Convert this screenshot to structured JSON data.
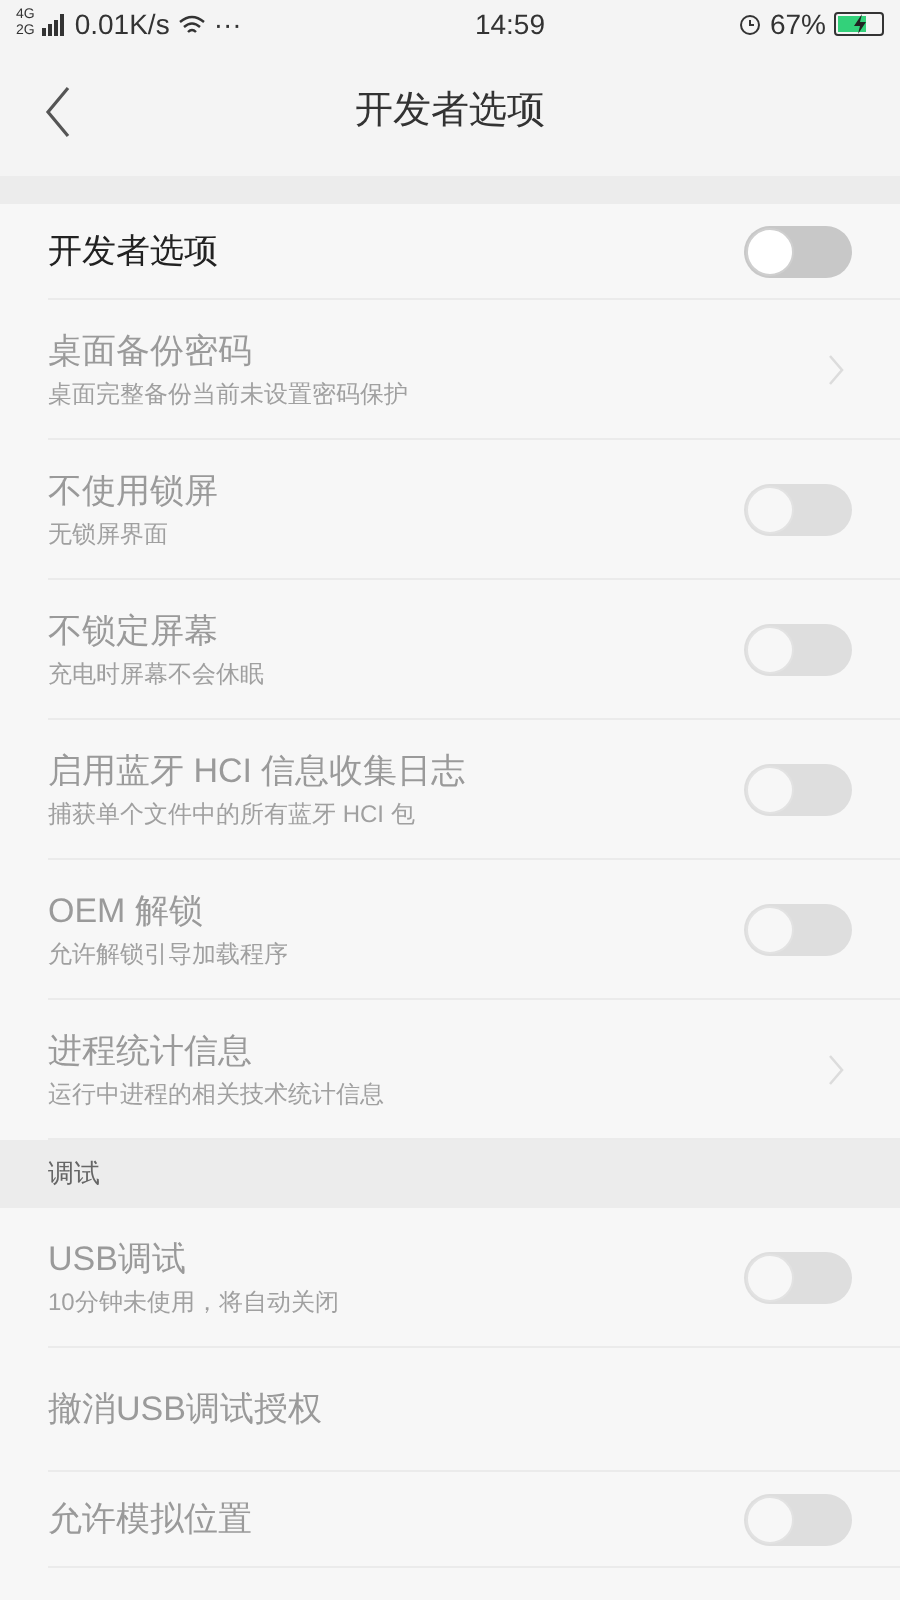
{
  "status_bar": {
    "network": [
      "4G",
      "2G"
    ],
    "speed": "0.01K/s",
    "more": "···",
    "time": "14:59",
    "battery": "67%",
    "charging": true
  },
  "header": {
    "title": "开发者选项"
  },
  "sections": [
    {
      "items": [
        {
          "kind": "toggle",
          "title": "开发者选项",
          "on": false,
          "disabled": false
        },
        {
          "kind": "link",
          "title": "桌面备份密码",
          "subtitle": "桌面完整备份当前未设置密码保护",
          "disabled": true
        },
        {
          "kind": "toggle",
          "title": "不使用锁屏",
          "subtitle": "无锁屏界面",
          "on": false,
          "disabled": true
        },
        {
          "kind": "toggle",
          "title": "不锁定屏幕",
          "subtitle": "充电时屏幕不会休眠",
          "on": false,
          "disabled": true
        },
        {
          "kind": "toggle",
          "title": "启用蓝牙 HCI 信息收集日志",
          "subtitle": "捕获单个文件中的所有蓝牙 HCI 包",
          "on": false,
          "disabled": true
        },
        {
          "kind": "toggle",
          "title": "OEM 解锁",
          "subtitle": "允许解锁引导加载程序",
          "on": false,
          "disabled": true
        },
        {
          "kind": "link",
          "title": "进程统计信息",
          "subtitle": "运行中进程的相关技术统计信息",
          "disabled": true
        }
      ]
    },
    {
      "header": "调试",
      "items": [
        {
          "kind": "toggle",
          "title": "USB调试",
          "subtitle": "10分钟未使用，将自动关闭",
          "on": false,
          "disabled": true
        },
        {
          "kind": "plain",
          "title": "撤消USB调试授权",
          "disabled": true
        },
        {
          "kind": "toggle",
          "title": "允许模拟位置",
          "on": false,
          "disabled": true
        }
      ]
    }
  ]
}
